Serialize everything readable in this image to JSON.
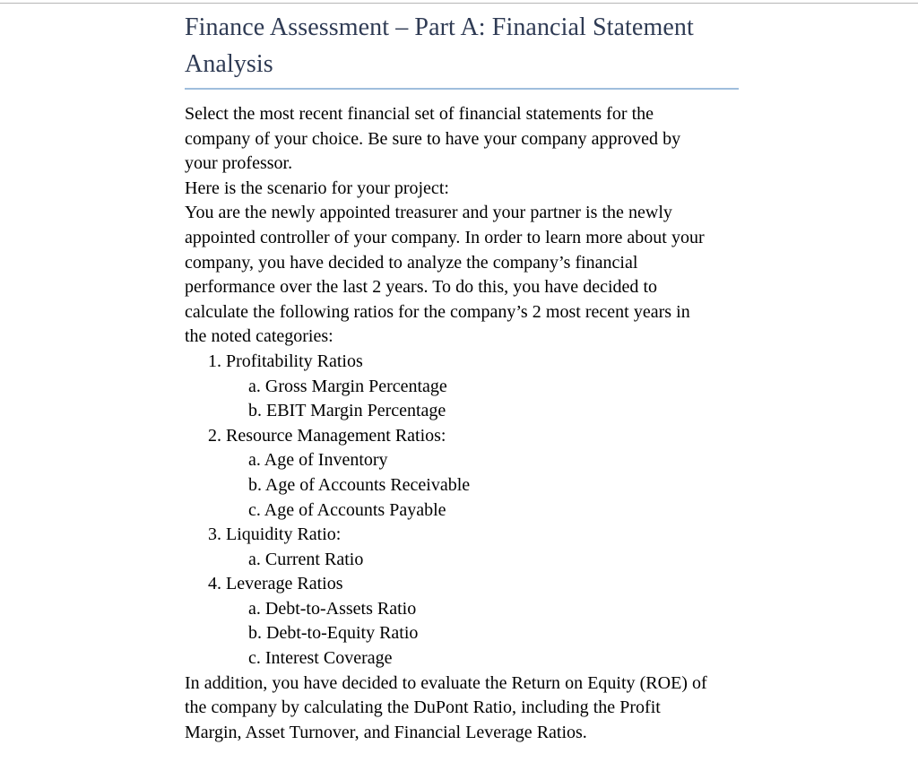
{
  "document": {
    "title": "Finance Assessment – Part A: Financial Statement Analysis",
    "title_color": "#2F3B54",
    "title_rule_color": "#9FBEDD",
    "body_color": "#000000",
    "background_color": "#FFFFFF"
  },
  "paragraphs": {
    "p1": "Select the most recent financial set of financial statements for the company of your choice. Be sure to have your company approved by your professor.",
    "p2": "Here is the scenario for your project:",
    "p3": "You are the newly appointed treasurer and your partner is the newly appointed controller of your company. In order to learn more about your company, you have decided to analyze the company’s financial performance over the last 2 years. To do this, you have decided to calculate the following ratios for the company’s 2 most recent years in the noted categories:",
    "p4": "In addition, you have decided to evaluate the Return on Equity (ROE) of the company by calculating the DuPont Ratio, including the Profit Margin, Asset Turnover, and Financial Leverage Ratios."
  },
  "ratio_list": [
    {
      "marker": "1.",
      "label": "Profitability Ratios",
      "children": [
        {
          "marker": "a.",
          "label": "Gross Margin Percentage"
        },
        {
          "marker": "b.",
          "label": "EBIT Margin Percentage"
        }
      ]
    },
    {
      "marker": "2.",
      "label": "Resource Management Ratios:",
      "children": [
        {
          "marker": "a.",
          "label": "Age of Inventory"
        },
        {
          "marker": "b.",
          "label": "Age of Accounts Receivable"
        },
        {
          "marker": "c.",
          "label": "Age of Accounts Payable"
        }
      ]
    },
    {
      "marker": "3.",
      "label": "Liquidity Ratio:",
      "children": [
        {
          "marker": "a.",
          "label": "Current Ratio"
        }
      ]
    },
    {
      "marker": "4.",
      "label": "Leverage Ratios",
      "children": [
        {
          "marker": "a.",
          "label": "Debt-to-Assets Ratio"
        },
        {
          "marker": "b.",
          "label": "Debt-to-Equity Ratio"
        },
        {
          "marker": "c.",
          "label": "Interest Coverage"
        }
      ]
    }
  ]
}
